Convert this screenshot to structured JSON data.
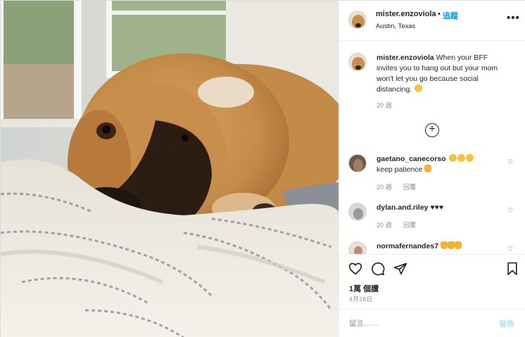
{
  "header": {
    "username": "mister.enzoviola",
    "separator": "•",
    "follow_label": "追蹤",
    "location": "Austin, Texas",
    "more_label": "•••"
  },
  "caption": {
    "username": "mister.enzoviola",
    "text": " When your BFF invites you to hang out but your mom won't let you go because social distancing. ",
    "age": "20 週"
  },
  "load_more_label": "+",
  "comments": [
    {
      "username": "gaetano_canecorso",
      "text": "keep patience ",
      "age": "20 週",
      "reply_label": "回覆"
    },
    {
      "username": "dylan.and.riley",
      "text": " ♥♥♥",
      "age": "20 週",
      "reply_label": "回覆"
    },
    {
      "username": "normafernandes7",
      "text": " ",
      "age": "",
      "reply_label": ""
    }
  ],
  "actions": {
    "likes_label": "1萬 個讚",
    "date": "4月28日"
  },
  "add_comment": {
    "placeholder": "留言……",
    "post_label": "發佈"
  },
  "colors": {
    "link": "#0095f6",
    "post_disabled": "#b2dffc",
    "secondary_text": "#8e8e8e",
    "border": "#efefef"
  },
  "icons": [
    "heart-icon",
    "comment-icon",
    "share-icon",
    "bookmark-icon",
    "more-options-icon",
    "add-circle-icon"
  ]
}
